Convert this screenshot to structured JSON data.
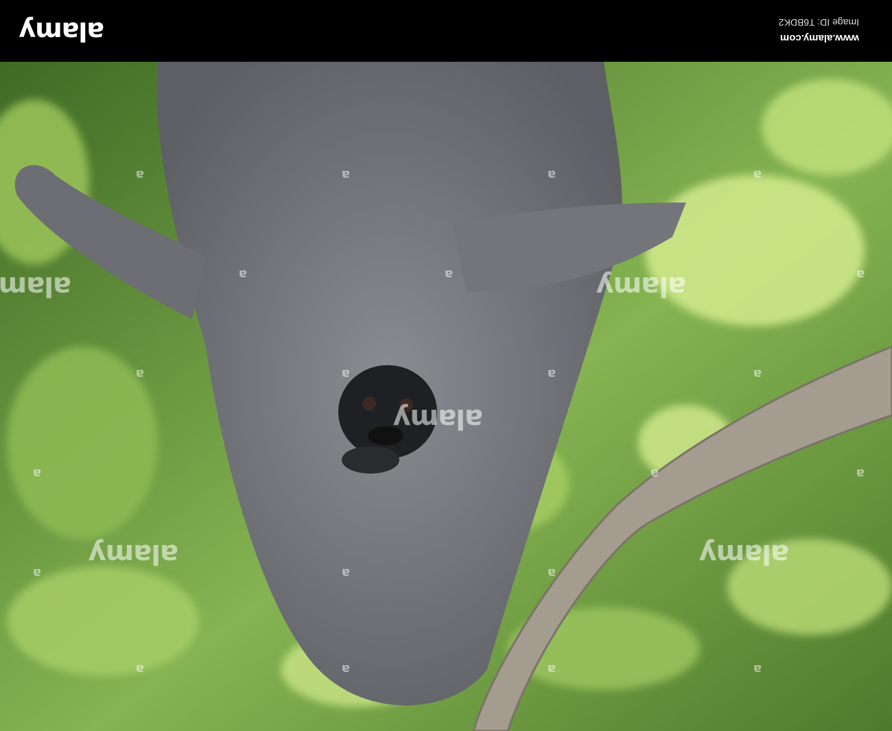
{
  "header": {
    "logo_text": "alamy",
    "site_url": "www.alamy.com",
    "image_id_text": "Image ID: T6BDK2",
    "background_color": "#000000"
  },
  "photo": {
    "watermark_text": "alamy",
    "watermark_mark": "a",
    "subject_icon": "gibbon-hanging-from-branch",
    "orientation": "upside-down",
    "colors": {
      "fur": "#7d7f84",
      "foliage": "#7fae4a",
      "bark": "#a09a8e"
    }
  }
}
